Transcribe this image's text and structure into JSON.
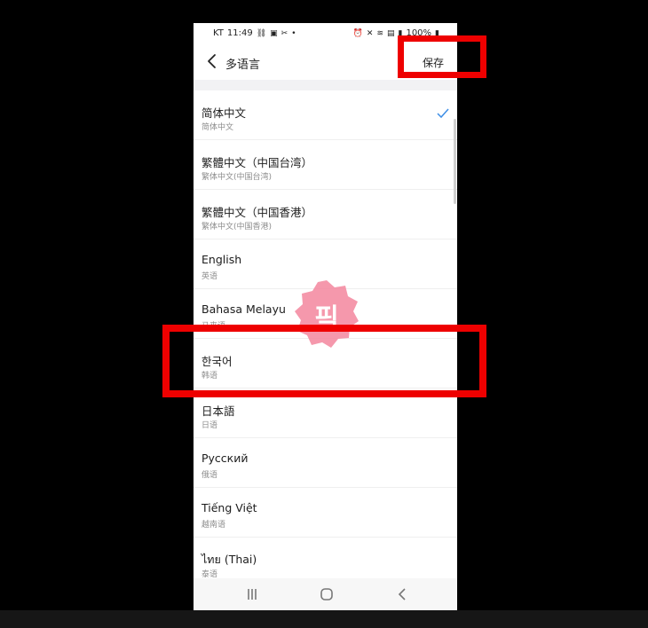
{
  "status_bar": {
    "carrier": "KT",
    "time": "11:49",
    "battery": "100%"
  },
  "header": {
    "title": "多语言",
    "save_label": "保存"
  },
  "languages": [
    {
      "name": "简体中文",
      "sub": "简体中文",
      "selected": true
    },
    {
      "name": "繁體中文（中国台湾）",
      "sub": "繁体中文(中国台湾)",
      "selected": false
    },
    {
      "name": "繁體中文（中国香港）",
      "sub": "繁体中文(中国香港)",
      "selected": false
    },
    {
      "name": "English",
      "sub": "英语",
      "selected": false
    },
    {
      "name": "Bahasa Melayu",
      "sub": "马来语",
      "selected": false
    },
    {
      "name": "한국어",
      "sub": "韩语",
      "selected": false
    },
    {
      "name": "日本語",
      "sub": "日语",
      "selected": false
    },
    {
      "name": "Русский",
      "sub": "俄语",
      "selected": false
    },
    {
      "name": "Tiếng Việt",
      "sub": "越南语",
      "selected": false
    },
    {
      "name": "ไทย (Thai)",
      "sub": "泰语",
      "selected": false
    }
  ],
  "sticker": {
    "text": "픽"
  },
  "colors": {
    "accent": "#3d8ee6",
    "highlight": "#ee0000",
    "sticker": "#f48aa0"
  },
  "icons": {
    "back": "chevron-left-icon",
    "check": "checkmark-icon",
    "nav_recent": "recent-apps-icon",
    "nav_home": "home-icon",
    "nav_back": "back-icon"
  }
}
